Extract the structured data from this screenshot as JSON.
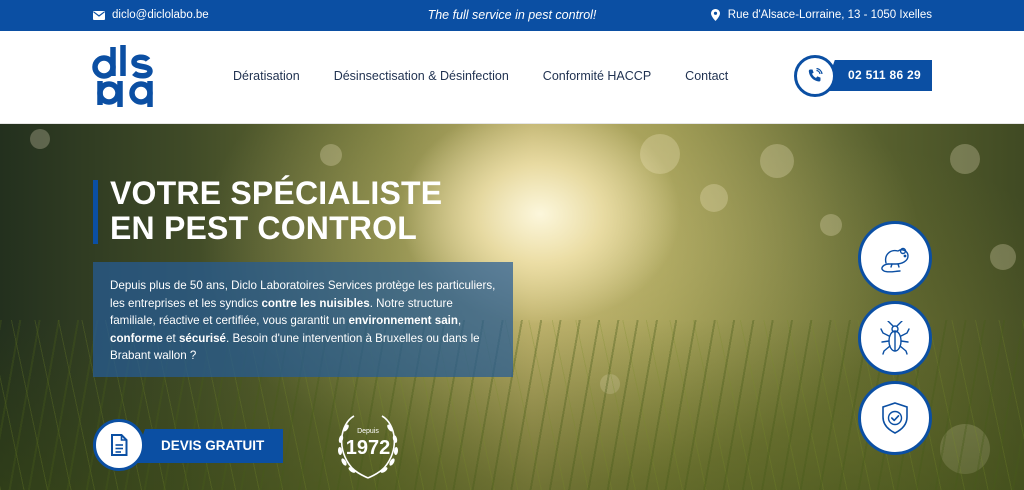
{
  "topbar": {
    "email": "diclo@diclolabo.be",
    "tagline": "The full service in pest control!",
    "address": "Rue d'Alsace-Lorraine, 13 - 1050 Ixelles"
  },
  "brand": {
    "logo_text": "dls",
    "accent": "#0b4fa3"
  },
  "nav": {
    "items": [
      {
        "label": "Dératisation"
      },
      {
        "label": "Désinsectisation & Désinfection"
      },
      {
        "label": "Conformité HACCP"
      },
      {
        "label": "Contact"
      }
    ]
  },
  "phone": {
    "number": "02 511 86 29",
    "icon": "phone-icon"
  },
  "hero": {
    "headline_line1": "VOTRE SPÉCIALISTE",
    "headline_line2": "EN PEST CONTROL",
    "intro": {
      "t1": "Depuis plus de 50 ans, Diclo Laboratoires Services protège les particuliers, les entreprises et les syndics ",
      "b1": "contre les nuisibles",
      "t2": ". Notre structure familiale, réactive et certifiée, vous garantit un ",
      "b2": "environnement sain",
      "t3": ", ",
      "b3": "conforme",
      "t4": " et ",
      "b4": "sécurisé",
      "t5": ". Besoin d'une intervention à Bruxelles ou dans le Brabant wallon ?"
    },
    "cta_label": "DEVIS GRATUIT",
    "badge_small": "Depuis",
    "badge_year": "1972"
  },
  "services": [
    {
      "icon": "rat-icon"
    },
    {
      "icon": "cockroach-icon"
    },
    {
      "icon": "shield-check-icon"
    }
  ]
}
